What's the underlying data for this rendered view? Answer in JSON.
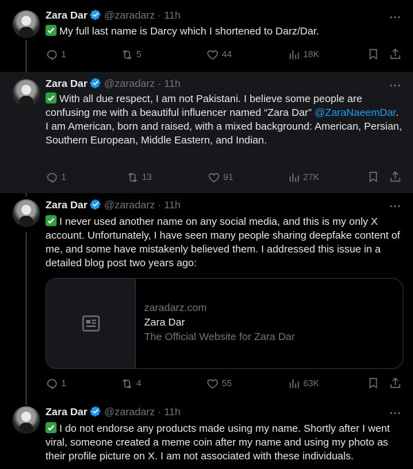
{
  "colors": {
    "background": "#000000",
    "highlight": "#16181c",
    "text": "#e7e9ea",
    "muted": "#71767b",
    "link": "#1d9bf0",
    "verified": "#1d9bf0",
    "check": "#2ea043"
  },
  "icons": {
    "verified": "verified-badge-icon",
    "more": "more-icon",
    "reply": "reply-icon",
    "retweet": "retweet-icon",
    "like": "heart-icon",
    "views": "views-icon",
    "bookmark": "bookmark-icon",
    "share": "share-icon",
    "card": "article-icon",
    "check": "check-mark-icon"
  },
  "tweets": [
    {
      "name": "Zara Dar",
      "handle": "@zaradarz",
      "dot": "·",
      "time": "11h",
      "text": "My full last name is Darcy which I shortened to Darz/Dar.",
      "replies": "1",
      "retweets": "5",
      "likes": "44",
      "views": "18K"
    },
    {
      "name": "Zara Dar",
      "handle": "@zaradarz",
      "dot": "·",
      "time": "11h",
      "text_before": "With all due respect, I am not Pakistani. I believe some people are confusing me with a beautiful influencer named “Zara Dar” ",
      "mention": "@ZaraNaeemDar",
      "text_after": ". I am American, born and raised, with a mixed background: American, Persian, Southern European, Middle Eastern, and Indian.",
      "replies": "1",
      "retweets": "13",
      "likes": "91",
      "views": "27K"
    },
    {
      "name": "Zara Dar",
      "handle": "@zaradarz",
      "dot": "·",
      "time": "11h",
      "text": "I never used another name on any social media, and this is my only X account. Unfortunately, I have seen many people sharing deepfake content of me, and some have mistakenly believed them. I addressed this issue in a detailed blog post two years ago:",
      "card": {
        "domain": "zaradarz.com",
        "title": "Zara Dar",
        "description": "The Official Website for Zara Dar"
      },
      "replies": "1",
      "retweets": "4",
      "likes": "55",
      "views": "63K"
    },
    {
      "name": "Zara Dar",
      "handle": "@zaradarz",
      "dot": "·",
      "time": "11h",
      "text": "I do not endorse any products made using my name. Shortly after I went viral, someone created a meme coin after my name and using my photo as their profile picture on X. I am not associated with these individuals."
    }
  ]
}
